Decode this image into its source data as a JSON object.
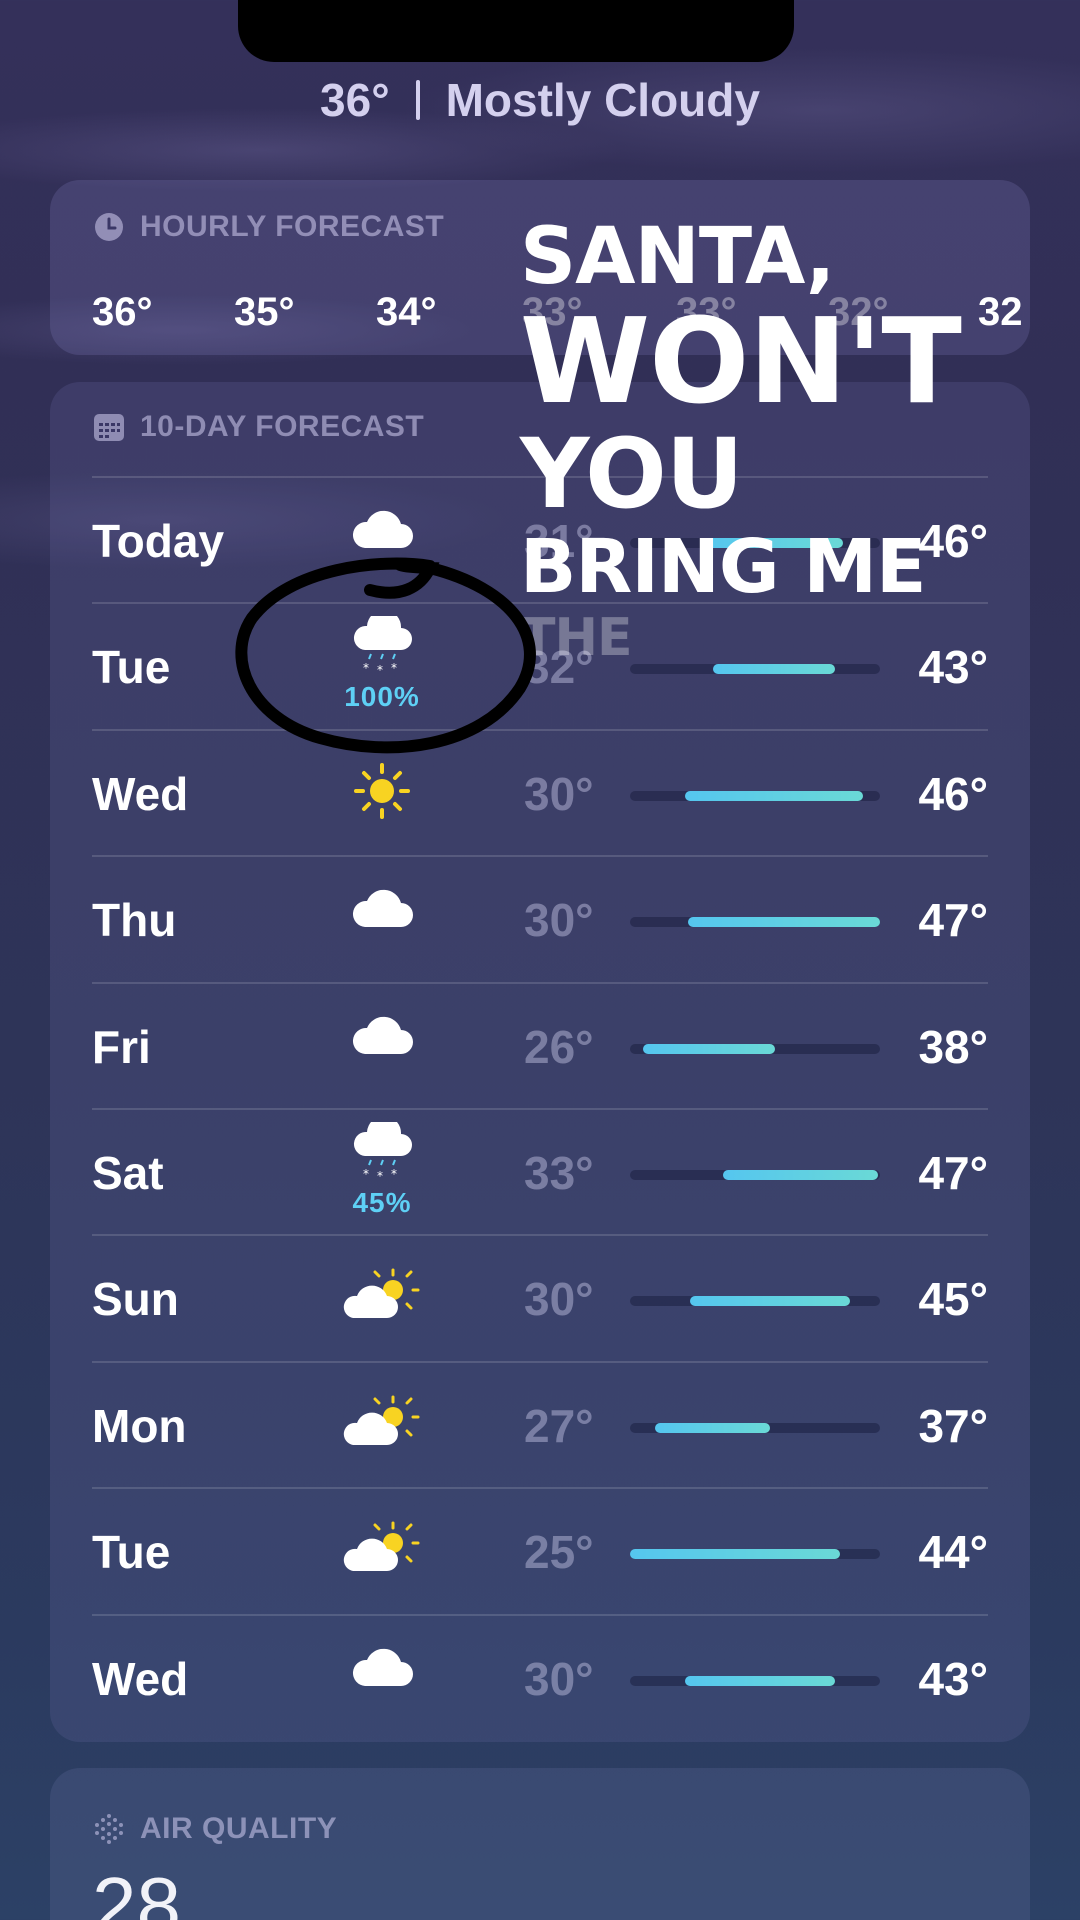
{
  "header": {
    "temperature": "36°",
    "condition": "Mostly Cloudy"
  },
  "hourly": {
    "title": "HOURLY FORECAST",
    "temps": [
      "36°",
      "35°",
      "34°",
      "33°",
      "33°",
      "32°",
      "32"
    ]
  },
  "ten_day": {
    "title": "10-DAY FORECAST",
    "rows": [
      {
        "day": "Today",
        "icon": "cloud-icon",
        "precip": "",
        "low": "31°",
        "high": "46°",
        "bar_start": 0.3,
        "bar_end": 0.85
      },
      {
        "day": "Tue",
        "icon": "cloud-snow-icon",
        "precip": "100%",
        "low": "32°",
        "high": "43°",
        "bar_start": 0.33,
        "bar_end": 0.82
      },
      {
        "day": "Wed",
        "icon": "sun-icon",
        "precip": "",
        "low": "30°",
        "high": "46°",
        "bar_start": 0.22,
        "bar_end": 0.93
      },
      {
        "day": "Thu",
        "icon": "cloud-icon",
        "precip": "",
        "low": "30°",
        "high": "47°",
        "bar_start": 0.23,
        "bar_end": 1.0
      },
      {
        "day": "Fri",
        "icon": "cloud-icon",
        "precip": "",
        "low": "26°",
        "high": "38°",
        "bar_start": 0.05,
        "bar_end": 0.58
      },
      {
        "day": "Sat",
        "icon": "cloud-snow-icon",
        "precip": "45%",
        "low": "33°",
        "high": "47°",
        "bar_start": 0.37,
        "bar_end": 0.99
      },
      {
        "day": "Sun",
        "icon": "partly-sunny-icon",
        "precip": "",
        "low": "30°",
        "high": "45°",
        "bar_start": 0.24,
        "bar_end": 0.88
      },
      {
        "day": "Mon",
        "icon": "partly-sunny-icon",
        "precip": "",
        "low": "27°",
        "high": "37°",
        "bar_start": 0.1,
        "bar_end": 0.56
      },
      {
        "day": "Tue",
        "icon": "partly-sunny-icon",
        "precip": "",
        "low": "25°",
        "high": "44°",
        "bar_start": 0.0,
        "bar_end": 0.84
      },
      {
        "day": "Wed",
        "icon": "cloud-icon",
        "precip": "",
        "low": "30°",
        "high": "43°",
        "bar_start": 0.22,
        "bar_end": 0.82
      }
    ]
  },
  "air_quality": {
    "title": "AIR QUALITY",
    "value": "28"
  },
  "overlay": {
    "line1": "SANTA,",
    "line2": "WON'T",
    "line3": "YOU",
    "line4": "BRING ME",
    "line5": "THE"
  },
  "colors": {
    "bar_start": "#55c6ef",
    "bar_end": "#6ad9d6",
    "precip": "#5ed0f5",
    "sun": "#f8d322"
  }
}
